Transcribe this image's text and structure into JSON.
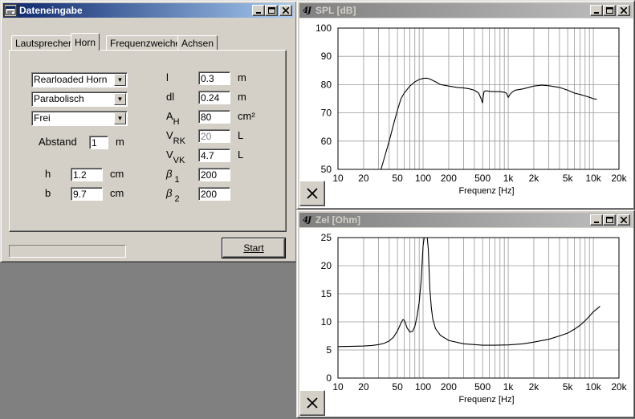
{
  "dlg": {
    "title": "Dateneingabe",
    "tabs": [
      "Lautsprecher",
      "Horn",
      "Frequenzweiche",
      "Achsen"
    ],
    "tab_accel": [
      "L",
      "H",
      "F",
      "A"
    ],
    "combos": [
      "Rearloaded Horn",
      "Parabolisch",
      "Frei"
    ],
    "abstand_label": "Abstand",
    "abstand_value": "1",
    "abstand_unit": "m",
    "h_label": "h",
    "h_value": "1.2",
    "h_unit": "cm",
    "b_label": "b",
    "b_value": "9.7",
    "b_unit": "cm",
    "params": [
      {
        "label": "l",
        "sub": "",
        "value": "0.3",
        "unit": "m",
        "disabled": false
      },
      {
        "label": "dl",
        "sub": "",
        "value": "0.24",
        "unit": "m",
        "disabled": false
      },
      {
        "label": "A",
        "sub": "H",
        "value": "80",
        "unit": "cm²",
        "disabled": false
      },
      {
        "label": "V",
        "sub": "RK",
        "value": "20",
        "unit": "L",
        "disabled": true
      },
      {
        "label": "V",
        "sub": "VK",
        "value": "4.7",
        "unit": "L",
        "disabled": false
      },
      {
        "label": "β",
        "sub": "1",
        "value": "200",
        "unit": "",
        "disabled": false
      },
      {
        "label": "β",
        "sub": "2",
        "value": "200",
        "unit": "",
        "disabled": false
      }
    ],
    "start_label": "Start",
    "progress": 0
  },
  "spl": {
    "title": "SPL [dB]",
    "logo": "4J"
  },
  "zel": {
    "title": "Zel [Ohm]",
    "logo": "4J"
  },
  "chart_data": [
    {
      "type": "line",
      "title": "SPL [dB]",
      "xlabel": "Frequenz [Hz]",
      "ylabel": "",
      "xscale": "log",
      "xlim": [
        10,
        20000
      ],
      "ylim": [
        50,
        100
      ],
      "xticks": [
        "10",
        "20",
        "50",
        "100",
        "200",
        "500",
        "1k",
        "2k",
        "5k",
        "10k",
        "20k"
      ],
      "yticks": [
        "50",
        "60",
        "70",
        "80",
        "90",
        "100"
      ],
      "x": [
        32,
        35,
        40,
        45,
        50,
        55,
        60,
        70,
        80,
        90,
        100,
        110,
        120,
        140,
        160,
        200,
        250,
        300,
        350,
        400,
        450,
        480,
        500,
        510,
        520,
        550,
        600,
        700,
        800,
        900,
        950,
        1000,
        1050,
        1100,
        1200,
        1500,
        2000,
        2500,
        3000,
        4000,
        5000,
        6000,
        7000,
        8000,
        9000,
        10000,
        11000
      ],
      "y": [
        50,
        54,
        60,
        66,
        71,
        75,
        77,
        79.5,
        81,
        81.8,
        82.2,
        82.3,
        82,
        81,
        80,
        79.5,
        79,
        78.8,
        78.5,
        78,
        77,
        75,
        73.5,
        76,
        77.5,
        77.8,
        77.6,
        77.5,
        77.5,
        77.3,
        77,
        75.5,
        76.5,
        77.2,
        78,
        78.5,
        79.5,
        79.8,
        79.6,
        79,
        78,
        77,
        76.5,
        76,
        75.5,
        75,
        74.8
      ]
    },
    {
      "type": "line",
      "title": "Zel [Ohm]",
      "xlabel": "Frequenz [Hz]",
      "ylabel": "",
      "xscale": "log",
      "xlim": [
        10,
        20000
      ],
      "ylim": [
        0,
        25
      ],
      "xticks": [
        "10",
        "20",
        "50",
        "100",
        "200",
        "500",
        "1k",
        "2k",
        "5k",
        "10k",
        "20k"
      ],
      "yticks": [
        "0",
        "5",
        "10",
        "15",
        "20",
        "25"
      ],
      "x": [
        10,
        15,
        20,
        25,
        30,
        35,
        40,
        45,
        50,
        55,
        58,
        60,
        62,
        65,
        70,
        75,
        80,
        85,
        90,
        95,
        100,
        103,
        106,
        108,
        110,
        112,
        115,
        120,
        125,
        130,
        140,
        160,
        200,
        300,
        500,
        700,
        1000,
        1500,
        2000,
        3000,
        4000,
        5000,
        6000,
        7000,
        8000,
        9000,
        10000,
        11000,
        12000
      ],
      "y": [
        5.6,
        5.65,
        5.7,
        5.8,
        5.95,
        6.2,
        6.6,
        7.3,
        8.4,
        9.8,
        10.4,
        10.3,
        9.8,
        8.9,
        8.2,
        8.3,
        9.2,
        11,
        13.5,
        17.5,
        23.5,
        25,
        25,
        25,
        25,
        25,
        23,
        16,
        12.5,
        10.5,
        8.8,
        7.6,
        6.7,
        6.1,
        5.85,
        5.85,
        5.9,
        6.1,
        6.4,
        6.9,
        7.5,
        8,
        8.7,
        9.4,
        10.2,
        11,
        11.8,
        12.3,
        12.8
      ]
    }
  ]
}
